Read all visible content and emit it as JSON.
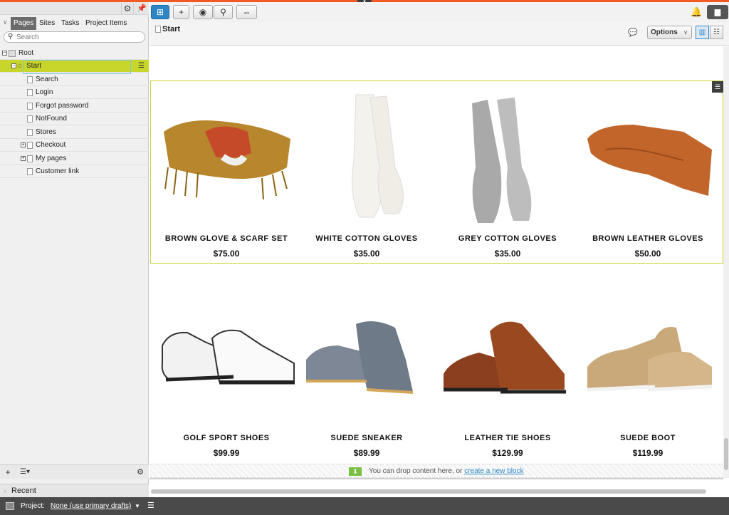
{
  "left_panel": {
    "tabs": [
      "Pages",
      "Sites",
      "Tasks",
      "Project Items"
    ],
    "search_placeholder": "Search",
    "tree": {
      "root": "Root",
      "start": "Start",
      "children": [
        "Search",
        "Login",
        "Forgot password",
        "NotFound",
        "Stores",
        "Checkout",
        "My pages",
        "Customer link"
      ]
    },
    "recent_label": "Recent"
  },
  "status_bar": {
    "project_label": "Project:",
    "project_value": "None (use primary drafts)"
  },
  "header": {
    "page_title": "Start",
    "options_label": "Options"
  },
  "products": [
    {
      "name": "BROWN GLOVE & SCARF SET",
      "price": "$75.00",
      "icon": "scarf-glove-image"
    },
    {
      "name": "WHITE COTTON GLOVES",
      "price": "$35.00",
      "icon": "white-gloves-image"
    },
    {
      "name": "GREY COTTON GLOVES",
      "price": "$35.00",
      "icon": "grey-gloves-image"
    },
    {
      "name": "BROWN LEATHER GLOVES",
      "price": "$50.00",
      "icon": "leather-gloves-image"
    },
    {
      "name": "GOLF SPORT SHOES",
      "price": "$99.99",
      "icon": "golf-shoes-image"
    },
    {
      "name": "SUEDE SNEAKER",
      "price": "$89.99",
      "icon": "suede-sneaker-image"
    },
    {
      "name": "LEATHER TIE SHOES",
      "price": "$129.99",
      "icon": "leather-shoes-image"
    },
    {
      "name": "SUEDE BOOT",
      "price": "$119.99",
      "icon": "suede-boot-image"
    }
  ],
  "dropzone": {
    "text": "You can drop content here, or",
    "link": "create a new block"
  },
  "colors": {
    "accent": "#f15a22",
    "selection": "#c8d52a",
    "primary_blue": "#2f86c4"
  }
}
